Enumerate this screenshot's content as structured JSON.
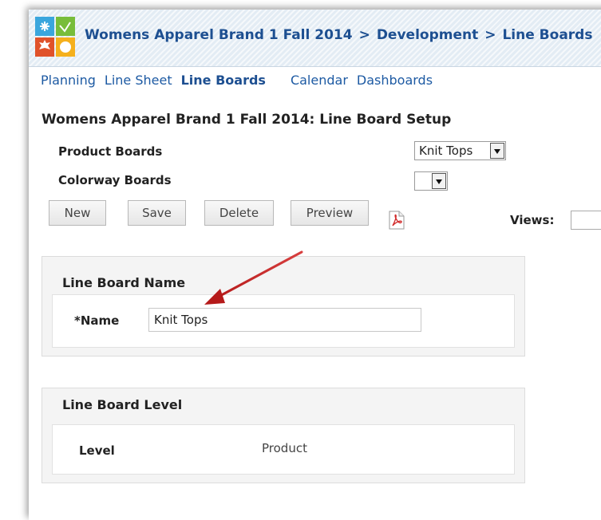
{
  "header": {
    "breadcrumb": [
      "Womens Apparel Brand 1 Fall 2014",
      "Development",
      "Line Boards"
    ],
    "separator": ">"
  },
  "nav": {
    "items": [
      "Planning",
      "Line Sheet",
      "Line Boards",
      "Calendar",
      "Dashboards"
    ],
    "active": "Line Boards"
  },
  "page": {
    "title": "Womens Apparel Brand 1 Fall 2014: Line Board Setup"
  },
  "form": {
    "product_boards_label": "Product Boards",
    "product_boards_value": "Knit Tops",
    "colorway_boards_label": "Colorway Boards",
    "colorway_boards_value": ""
  },
  "toolbar": {
    "new_label": "New",
    "save_label": "Save",
    "delete_label": "Delete",
    "preview_label": "Preview",
    "views_label": "Views:"
  },
  "name_section": {
    "title": "Line Board Name",
    "name_label": "*Name",
    "name_value": "Knit Tops"
  },
  "level_section": {
    "title": "Line Board Level",
    "level_label": "Level",
    "level_value": "Product"
  },
  "colors": {
    "link": "#1d5aa3",
    "header_text": "#1d4f91",
    "annotation_arrow": "#c42020"
  },
  "icons": [
    "app-logo-icon",
    "pdf-icon",
    "dropdown-arrow-icon"
  ]
}
